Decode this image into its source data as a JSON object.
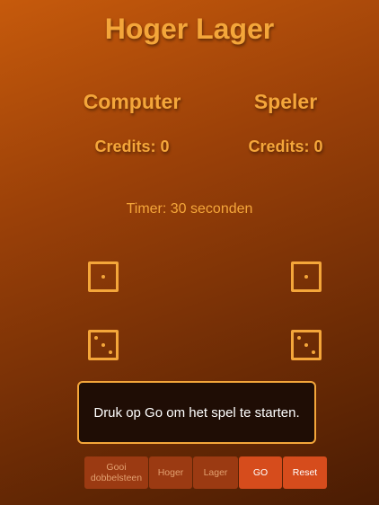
{
  "title": "Hoger Lager",
  "computer": {
    "name": "Computer",
    "credits_label": "Credits: 0",
    "dice": [
      1,
      3
    ]
  },
  "player": {
    "name": "Speler",
    "credits_label": "Credits: 0",
    "dice": [
      1,
      3
    ]
  },
  "timer": "Timer: 30 seconden",
  "message": "Druk op Go om het spel te starten.",
  "buttons": {
    "roll": "Gooi dobbelsteen",
    "higher": "Hoger",
    "lower": "Lager",
    "go": "GO",
    "reset": "Reset"
  },
  "colors": {
    "accent": "#f4a63a",
    "button_active": "#d64c1c",
    "button_disabled": "#9b3a12",
    "message_bg": "#1f0d05"
  }
}
